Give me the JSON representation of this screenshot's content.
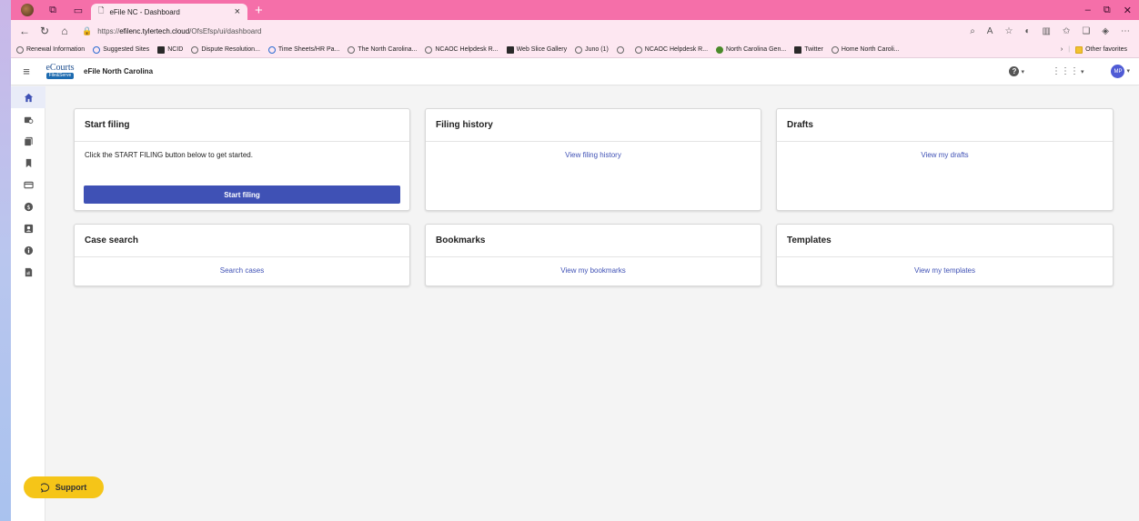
{
  "browser": {
    "tab_title": "eFile NC - Dashboard",
    "url_prefix": "https://",
    "url_host": "efilenc.tylertech.cloud",
    "url_path": "/OfsEfsp/ui/dashboard",
    "favorites": [
      {
        "label": "Renewal Information",
        "icon": "circle-icon"
      },
      {
        "label": "Suggested Sites",
        "icon": "search-icon"
      },
      {
        "label": "NCID",
        "icon": "nc-icon"
      },
      {
        "label": "Dispute Resolution...",
        "icon": "circle-icon"
      },
      {
        "label": "Time Sheets/HR Pa...",
        "icon": "tt-icon"
      },
      {
        "label": "The North Carolina...",
        "icon": "nc-logo-icon"
      },
      {
        "label": "NCAOC Helpdesk R...",
        "icon": "circle-icon"
      },
      {
        "label": "Web Slice Gallery",
        "icon": "slice-icon"
      },
      {
        "label": "Juno (1)",
        "icon": "juno-icon"
      },
      {
        "label": "",
        "icon": "page-icon"
      },
      {
        "label": "NCAOC Helpdesk R...",
        "icon": "circle-icon"
      },
      {
        "label": "North Carolina Gen...",
        "icon": "globe-icon"
      },
      {
        "label": "Twitter",
        "icon": "x-icon"
      },
      {
        "label": "Home North Caroli...",
        "icon": "nc-logo-icon"
      }
    ],
    "other_favorites": "Other favorites"
  },
  "app": {
    "logo_top": "eCourts",
    "logo_bottom": "File&Serve",
    "brand": "eFile North Carolina",
    "user_initials": "MP"
  },
  "cards": {
    "start_filing": {
      "title": "Start filing",
      "text": "Click the START FILING button below to get started.",
      "button": "Start filing"
    },
    "filing_history": {
      "title": "Filing history",
      "link": "View filing history"
    },
    "drafts": {
      "title": "Drafts",
      "link": "View my drafts"
    },
    "case_search": {
      "title": "Case search",
      "link": "Search cases"
    },
    "bookmarks": {
      "title": "Bookmarks",
      "link": "View my bookmarks"
    },
    "templates": {
      "title": "Templates",
      "link": "View my templates"
    }
  },
  "support": {
    "label": "Support"
  },
  "colors": {
    "accent": "#3f51b5",
    "tabstrip": "#f56fa9",
    "support": "#f5c518"
  }
}
